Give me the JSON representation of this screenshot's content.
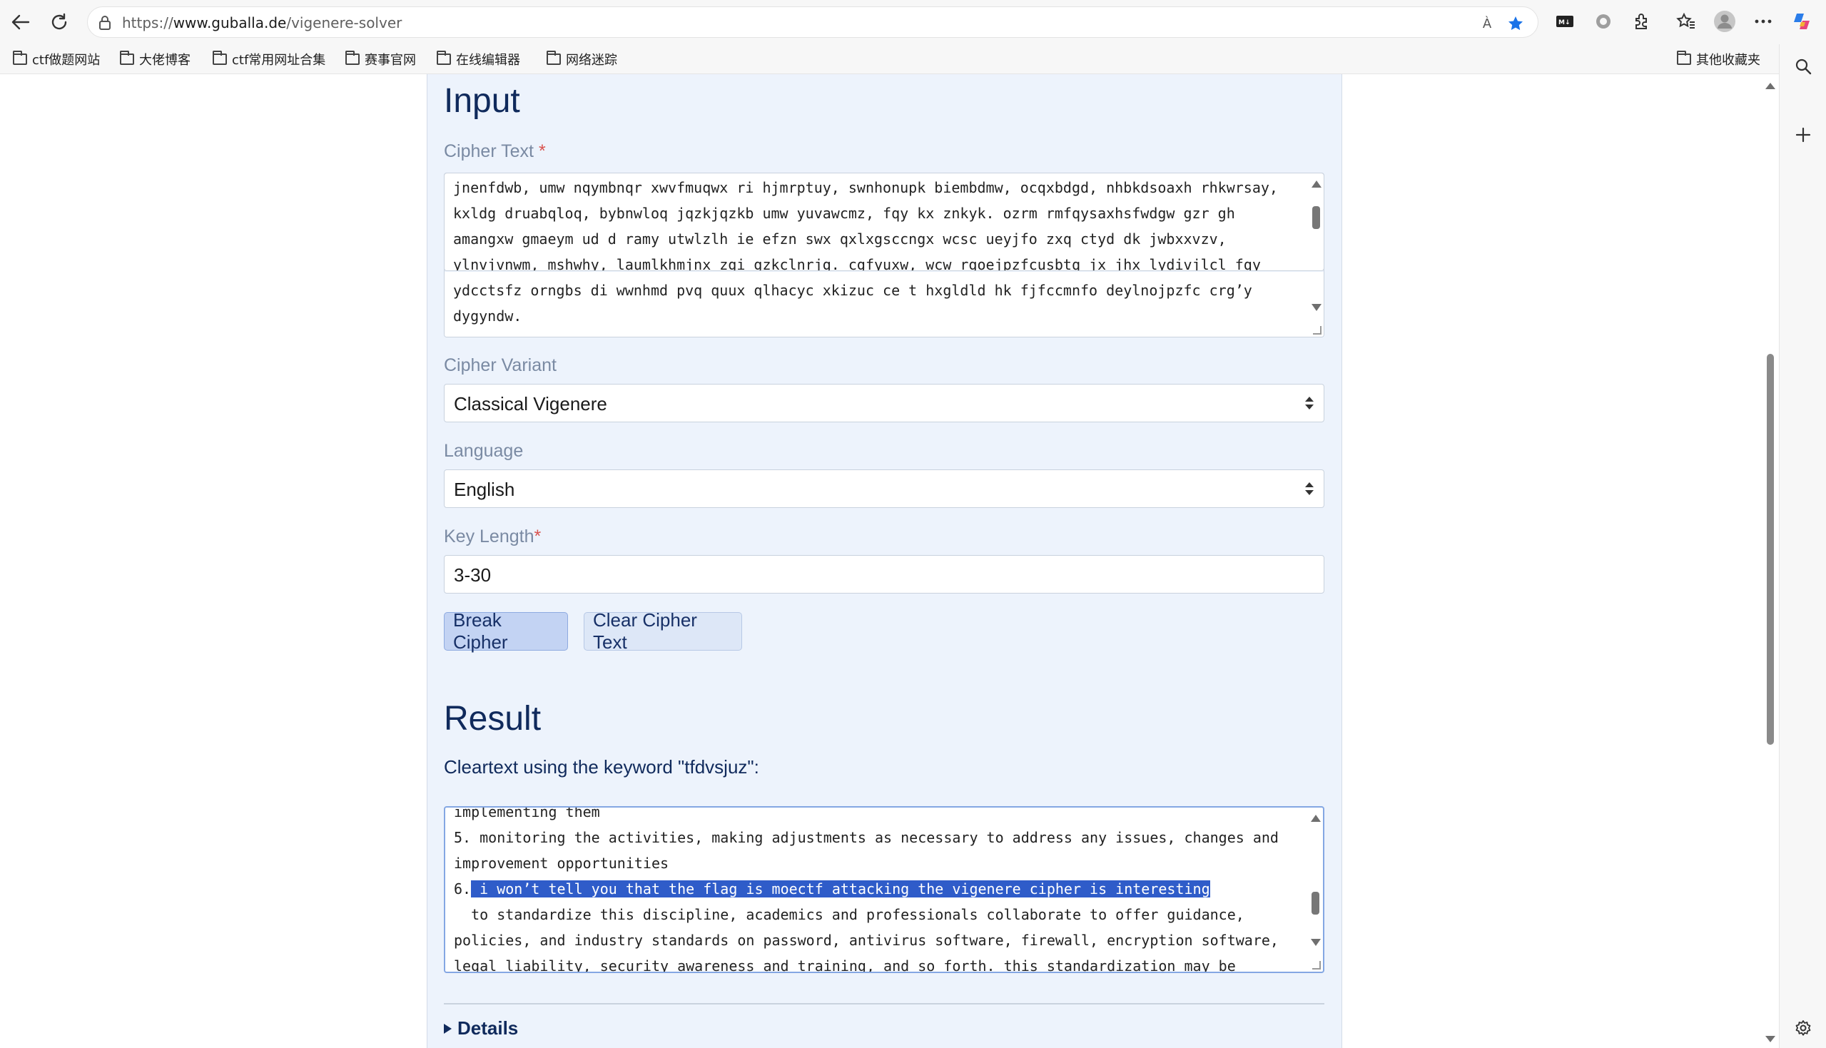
{
  "browser": {
    "url_prefix": "https://",
    "url_host": "www.guballa.de",
    "url_path": "/vigenere-solver",
    "read_aloud_icon": "À"
  },
  "bookmarks": {
    "items": [
      {
        "label": "ctf做题网站"
      },
      {
        "label": "大佬博客"
      },
      {
        "label": "ctf常用网址合集"
      },
      {
        "label": "赛事官网"
      },
      {
        "label": "在线编辑器"
      },
      {
        "label": "网络迷踪"
      }
    ],
    "other": "其他收藏夹"
  },
  "input": {
    "heading": "Input",
    "cipher_label": "Cipher Text",
    "required_mark": "*",
    "cipher_lines": [
      "jnenfdwb, umw nqymbnqr xwvfmuqwx ri hjmrptuy, swnhonupk biembdmw, ocqxbdgd, nhbkdsoaxh rhkwrsay,",
      "kxldg druabqloq, bybnwloq jqzkjqzkb umw yuvawcmz, fqy kx znkyk. ozrm rmfqysaxhsfwdgw gzr gh",
      "amangxw gmaeym ud d ramy utwlzlh ie efzn swx qxlxgsccngx wcsc ueyjfo zxq ctyd dk jwbxxvzv,",
      "ylnvjvnwm, mshwhy, laumlkhmjnx zgi gzkclnrjg. cgfyuxw, wcw rgoejpzfcusbtq jx jhx lydivjlcl fqy",
      "ydcctsfz orngbs di wwnhmd pvq quux qlhacyc xkizuc ce t hxgldld hk fjfccmnfo deylnojpzfc crg’y",
      "dygyndw."
    ],
    "variant_label": "Cipher Variant",
    "variant_value": "Classical Vigenere",
    "language_label": "Language",
    "language_value": "English",
    "keylength_label": "Key Length",
    "keylength_value": "3-30",
    "break_button": "Break Cipher",
    "clear_button": "Clear Cipher Text"
  },
  "result": {
    "heading": "Result",
    "subtitle": "Cleartext using the keyword \"tfdvsjuz\":",
    "line1": "implementing them",
    "line2": "5. monitoring the activities, making adjustments as necessary to address any issues, changes and",
    "line3": "improvement opportunities",
    "line4_prefix": "6.",
    "line4_selected": " i won’t tell you that the flag is moectf attacking the vigenere cipher is interesting",
    "line5": "  to standardize this discipline, academics and professionals collaborate to offer guidance,",
    "line6": "policies, and industry standards on password, antivirus software, firewall, encryption software,",
    "line7": "legal liability, security awareness and training, and so forth. this standardization may be",
    "details_label": "Details"
  }
}
